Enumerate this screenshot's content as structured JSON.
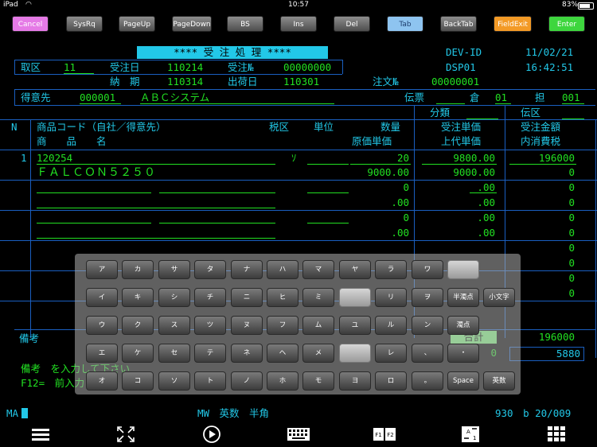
{
  "statusbar": {
    "device": "iPad",
    "time": "10:57",
    "battery": "83%"
  },
  "toolbar": {
    "buttons": [
      {
        "label": "Cancel",
        "color": "#e57ae6"
      },
      {
        "label": "SysRq",
        "color": "#6e6e6e"
      },
      {
        "label": "PageUp",
        "color": "#6e6e6e"
      },
      {
        "label": "PageDown",
        "color": "#6e6e6e"
      },
      {
        "label": "BS",
        "color": "#6e6e6e"
      },
      {
        "label": "Ins",
        "color": "#6e6e6e"
      },
      {
        "label": "Del",
        "color": "#6e6e6e"
      },
      {
        "label": "Tab",
        "color": "#8ec4f0"
      },
      {
        "label": "BackTab",
        "color": "#6e6e6e"
      },
      {
        "label": "FieldExit",
        "color": "#f39a26"
      },
      {
        "label": "Enter",
        "color": "#3ed63e"
      }
    ]
  },
  "screen": {
    "title": "**** 受 注 処 理 ****",
    "dev_id_label": "DEV-ID",
    "date": "11/02/21",
    "dev": "DSP01",
    "clock": "16:42:51",
    "row1": {
      "torikubun_label": "取区",
      "torikubun": "11",
      "juchubi_label": "受注日",
      "juchubi": "110214",
      "juchuno_label": "受注№",
      "juchuno": "00000000"
    },
    "row2": {
      "noki_label": "納　期",
      "noki": "110314",
      "shukka_label": "出荷日",
      "shukka": "110301",
      "chumon_label": "注文№",
      "chumon": "00000001"
    },
    "row3": {
      "tokuisaki_label": "得意先",
      "tokuisaki_code": "000001",
      "tokuisaki_name": "ＡＢＣシステム",
      "denpyo_label": "伝票",
      "kura_label": "倉",
      "kura": "01",
      "tanto_label": "担",
      "tanto": "001"
    },
    "row4": {
      "bunrui_label": "分類",
      "denku_label": "伝区"
    },
    "header": {
      "n": "N",
      "shohin_code": "商品コード（自社／得意先）",
      "zeiku": "税区",
      "tani": "単位",
      "suryo": "数量",
      "juchu_tanka": "受注単価",
      "juchu_kingaku": "受注金額",
      "shohin_mei": "商　　品　　名",
      "genka_tanka": "原価単価",
      "jodai_tanka": "上代単価",
      "uchi_shohizei": "内消費税"
    },
    "lines": [
      {
        "n": "1",
        "code": "120254",
        "zei": "ｿ",
        "qty": "20",
        "price": "9800.00",
        "amount": "196000",
        "name": "ＦＡＬＣＯＮ５２５０",
        "cost": "9000.00",
        "retail": "9000.00",
        "tax": "0"
      },
      {
        "qty": "0",
        "price": ".00",
        "amount": "0",
        "cost": ".00",
        "retail": ".00",
        "tax": "0"
      },
      {
        "qty": "0",
        "price": ".00",
        "amount": "0",
        "cost": ".00",
        "retail": ".00",
        "tax": "0"
      },
      {
        "qty": "0",
        "price": ".00",
        "amount": "0",
        "cost": ".00",
        "retail": ".00",
        "tax": "0"
      },
      {
        "qty": "0",
        "price": ".00",
        "amount": "0",
        "cost": ".00",
        "retail": ".00",
        "tax": "0"
      }
    ],
    "biko_label": "備考",
    "gokei_label": "合計",
    "gokei_amount": "196000",
    "gokei_tax": "5880",
    "gokei_zero": "0",
    "message1": "備考　を入力して下さい",
    "message2": "F12=　前入力"
  },
  "keyboard": {
    "rows": [
      [
        "ア",
        "カ",
        "サ",
        "タ",
        "ナ",
        "ハ",
        "マ",
        "ヤ",
        "ラ",
        "ワ",
        ""
      ],
      [
        "イ",
        "キ",
        "シ",
        "チ",
        "ニ",
        "ヒ",
        "ミ",
        "",
        "リ",
        "ヲ",
        "半濁点",
        "小文字"
      ],
      [
        "ウ",
        "ク",
        "ス",
        "ツ",
        "ヌ",
        "フ",
        "ム",
        "ユ",
        "ル",
        "ン",
        "濁点"
      ],
      [
        "エ",
        "ケ",
        "セ",
        "テ",
        "ネ",
        "ヘ",
        "メ",
        "",
        "レ",
        "、",
        "・"
      ],
      [
        "オ",
        "コ",
        "ソ",
        "ト",
        "ノ",
        "ホ",
        "モ",
        "ヨ",
        "ロ",
        "。",
        "Space",
        "英数"
      ]
    ]
  },
  "bottomline": {
    "left": "MA",
    "mode": "MW　英数　半角",
    "right": "930　b 20/009"
  }
}
